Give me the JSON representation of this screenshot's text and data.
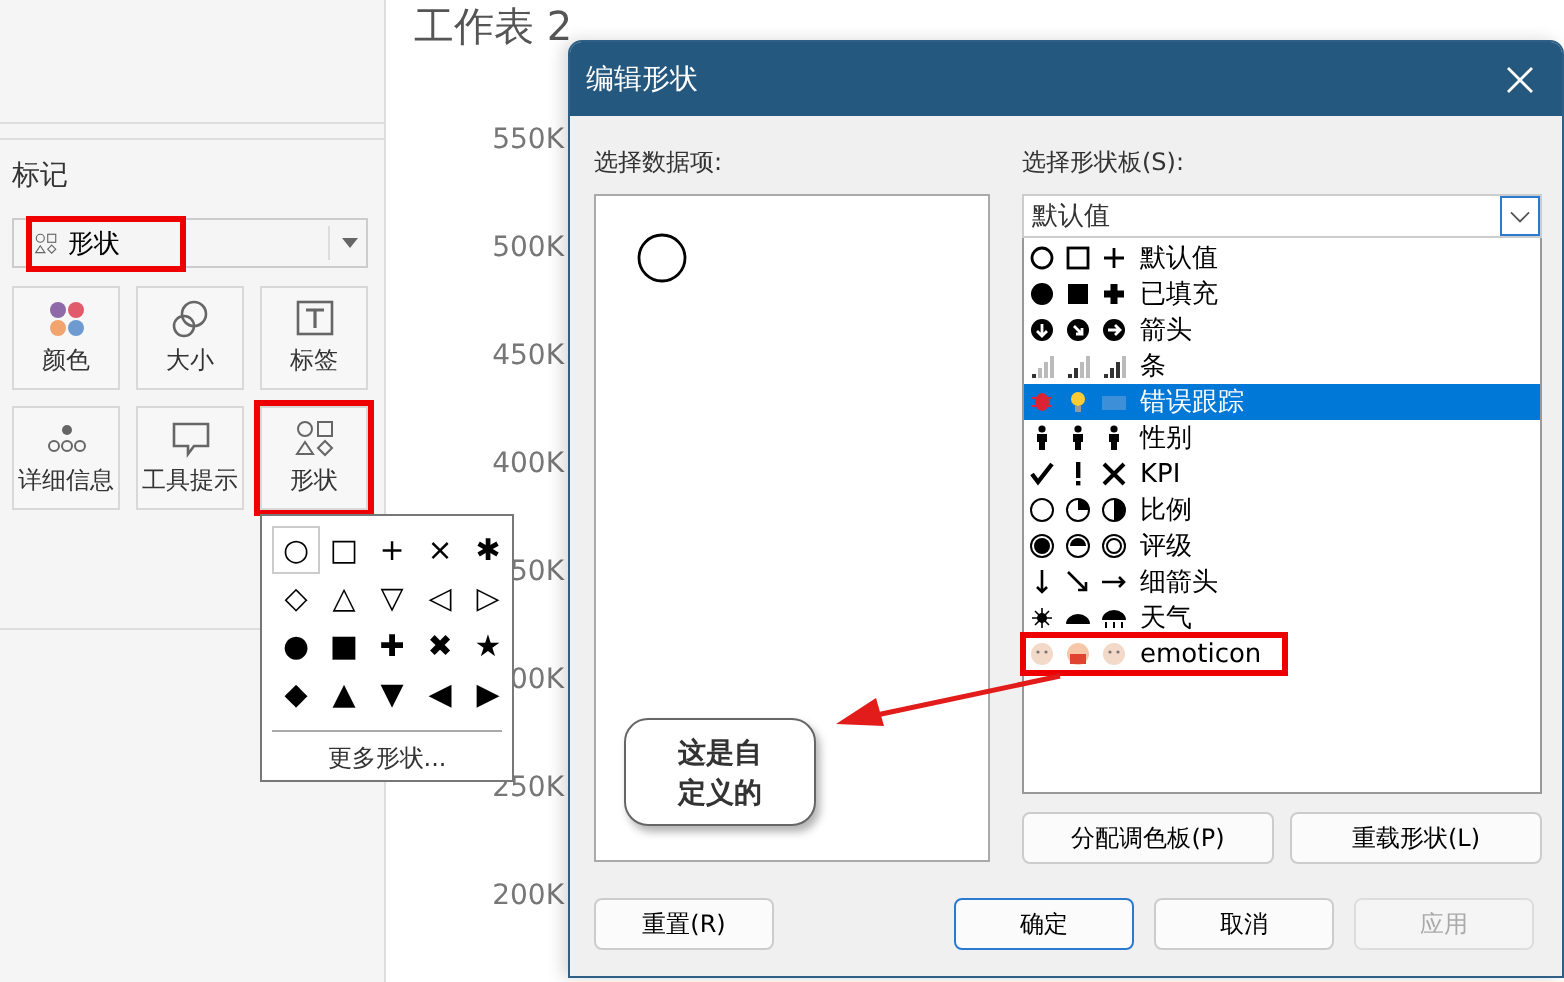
{
  "sheet_title": "工作表 2",
  "marks": {
    "title": "标记",
    "mark_type": {
      "label": "形状",
      "highlighted": true
    },
    "cards": [
      {
        "kind": "color",
        "label": "颜色",
        "highlighted": false
      },
      {
        "kind": "size",
        "label": "大小",
        "highlighted": false
      },
      {
        "kind": "label",
        "label": "标签",
        "highlighted": false
      },
      {
        "kind": "detail",
        "label": "详细信息",
        "highlighted": false
      },
      {
        "kind": "tooltip",
        "label": "工具提示",
        "highlighted": false
      },
      {
        "kind": "shape",
        "label": "形状",
        "highlighted": true
      }
    ]
  },
  "axis_labels": [
    "550K",
    "500K",
    "450K",
    "400K",
    "50K",
    "00K",
    "250K",
    "200K"
  ],
  "shape_popup": {
    "shapes": [
      {
        "glyph": "○",
        "selected": true
      },
      {
        "glyph": "□",
        "selected": false
      },
      {
        "glyph": "+",
        "selected": false
      },
      {
        "glyph": "×",
        "selected": false
      },
      {
        "glyph": "✱",
        "selected": false
      },
      {
        "glyph": "◇",
        "selected": false
      },
      {
        "glyph": "△",
        "selected": false
      },
      {
        "glyph": "▽",
        "selected": false
      },
      {
        "glyph": "◁",
        "selected": false
      },
      {
        "glyph": "▷",
        "selected": false
      },
      {
        "glyph": "●",
        "selected": false
      },
      {
        "glyph": "■",
        "selected": false
      },
      {
        "glyph": "✚",
        "selected": false
      },
      {
        "glyph": "✖",
        "selected": false
      },
      {
        "glyph": "★",
        "selected": false
      },
      {
        "glyph": "◆",
        "selected": false
      },
      {
        "glyph": "▲",
        "selected": false
      },
      {
        "glyph": "▼",
        "selected": false
      },
      {
        "glyph": "◀",
        "selected": false
      },
      {
        "glyph": "▶",
        "selected": false
      }
    ],
    "more": "更多形状..."
  },
  "dialog": {
    "title": "编辑形状",
    "data_items_label": "选择数据项:",
    "palette_label": "选择形状板(S):",
    "palette_value": "默认值",
    "palettes": [
      {
        "kind": "default",
        "label": "默认值",
        "selected": false,
        "highlighted": false
      },
      {
        "kind": "filled",
        "label": "已填充",
        "selected": false,
        "highlighted": false
      },
      {
        "kind": "arrows",
        "label": "箭头",
        "selected": false,
        "highlighted": false
      },
      {
        "kind": "bars",
        "label": "条",
        "selected": false,
        "highlighted": false
      },
      {
        "kind": "bug",
        "label": "错误跟踪",
        "selected": true,
        "highlighted": false
      },
      {
        "kind": "gender",
        "label": "性别",
        "selected": false,
        "highlighted": false
      },
      {
        "kind": "kpi",
        "label": "KPI",
        "selected": false,
        "highlighted": false
      },
      {
        "kind": "ratio",
        "label": "比例",
        "selected": false,
        "highlighted": false
      },
      {
        "kind": "rating",
        "label": "评级",
        "selected": false,
        "highlighted": false
      },
      {
        "kind": "thin-arrows",
        "label": "细箭头",
        "selected": false,
        "highlighted": false
      },
      {
        "kind": "weather",
        "label": "天气",
        "selected": false,
        "highlighted": false
      },
      {
        "kind": "emoticon",
        "label": "emoticon",
        "selected": false,
        "highlighted": true
      }
    ],
    "palette_buttons": [
      "分配调色板(P)",
      "重载形状(L)"
    ],
    "buttons": [
      {
        "label": "重置(R)",
        "kind": "normal"
      },
      {
        "label": "确定",
        "kind": "default"
      },
      {
        "label": "取消",
        "kind": "normal"
      },
      {
        "label": "应用",
        "kind": "disabled"
      }
    ]
  },
  "callout": {
    "text": "这是自定义的"
  }
}
